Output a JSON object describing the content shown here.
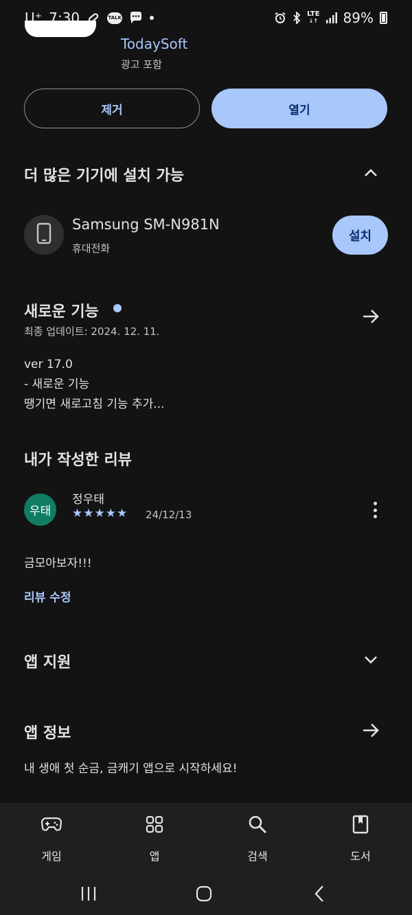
{
  "status_bar": {
    "carrier": "U⁺",
    "time": "7:30",
    "talk_label": "TALK",
    "network": "LTE",
    "battery": "89%"
  },
  "app": {
    "developer": "TodaySoft",
    "ads_notice": "광고 포함",
    "remove_label": "제거",
    "open_label": "열기"
  },
  "more_devices": {
    "title": "더 많은 기기에 설치 가능",
    "device_name": "Samsung SM-N981N",
    "device_type": "휴대전화",
    "install_label": "설치"
  },
  "whats_new": {
    "title": "새로운 기능",
    "updated": "최종 업데이트: 2024. 12. 11.",
    "lines": [
      "ver 17.0",
      "- 새로운 기능",
      "땡기면 새로고침 기능 추가..."
    ]
  },
  "my_review": {
    "title": "내가 작성한 리뷰",
    "avatar_text": "우태",
    "reviewer": "정우태",
    "stars": "★★★★★",
    "rating": 5,
    "date": "24/12/13",
    "text": "금모아보자!!!",
    "edit_label": "리뷰 수정"
  },
  "app_support": {
    "title": "앱 지원"
  },
  "app_info": {
    "title": "앱 정보",
    "description": "내 생애 첫 순금, 금캐기 앱으로 시작하세요!"
  },
  "bottom_nav": [
    {
      "label": "게임",
      "icon": "gamepad-icon"
    },
    {
      "label": "앱",
      "icon": "apps-grid-icon"
    },
    {
      "label": "검색",
      "icon": "search-icon"
    },
    {
      "label": "도서",
      "icon": "book-icon"
    }
  ],
  "colors": {
    "background": "#131314",
    "accent": "#a8c7fa",
    "avatar": "#0f7d62"
  }
}
